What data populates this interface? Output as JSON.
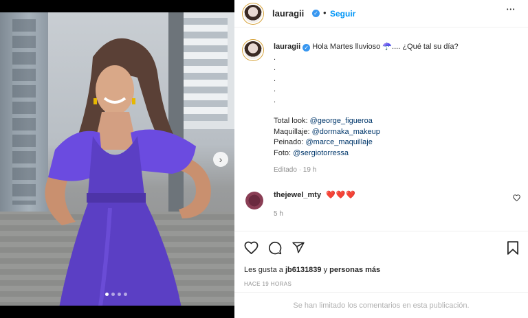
{
  "post": {
    "username": "lauragii",
    "verified_mark": "✓",
    "separator": "•",
    "follow_label": "Seguir",
    "more_label": "•••",
    "carousel": {
      "slide_count": 4,
      "active_index": 0,
      "next_arrow": "›"
    }
  },
  "caption": {
    "username": "lauragii",
    "text": "Hola Martes lluvioso ☂️.... ¿Qué tal su día?",
    "dots": [
      ".",
      ".",
      ".",
      ".",
      "."
    ],
    "credits": [
      {
        "label": "Total look: ",
        "mention": "@george_figueroa"
      },
      {
        "label": "Maquillaje: ",
        "mention": "@dormaka_makeup"
      },
      {
        "label": "Peinado: ",
        "mention": "@marce_maquillaje"
      },
      {
        "label": "Foto: ",
        "mention": "@sergiotorressa"
      }
    ],
    "meta": "Editado · 19 h"
  },
  "comment": {
    "username": "thejewel_mty",
    "hearts": "❤️❤️❤️",
    "meta": "5 h"
  },
  "actions": {
    "likes_prefix": "Les gusta a ",
    "likes_user": "jb6131839",
    "likes_mid": " y ",
    "likes_suffix": "personas más",
    "time": "HACE 19 HORAS",
    "limited": "Se han limitado los comentarios en esta publicación."
  },
  "icons": [
    "heart-icon",
    "comment-icon",
    "share-icon",
    "bookmark-icon",
    "more-icon",
    "verified-icon"
  ],
  "colors": {
    "link": "#0095f6",
    "mention": "#00376b",
    "verified": "#3897f0",
    "dress": "#5b3fc4"
  }
}
